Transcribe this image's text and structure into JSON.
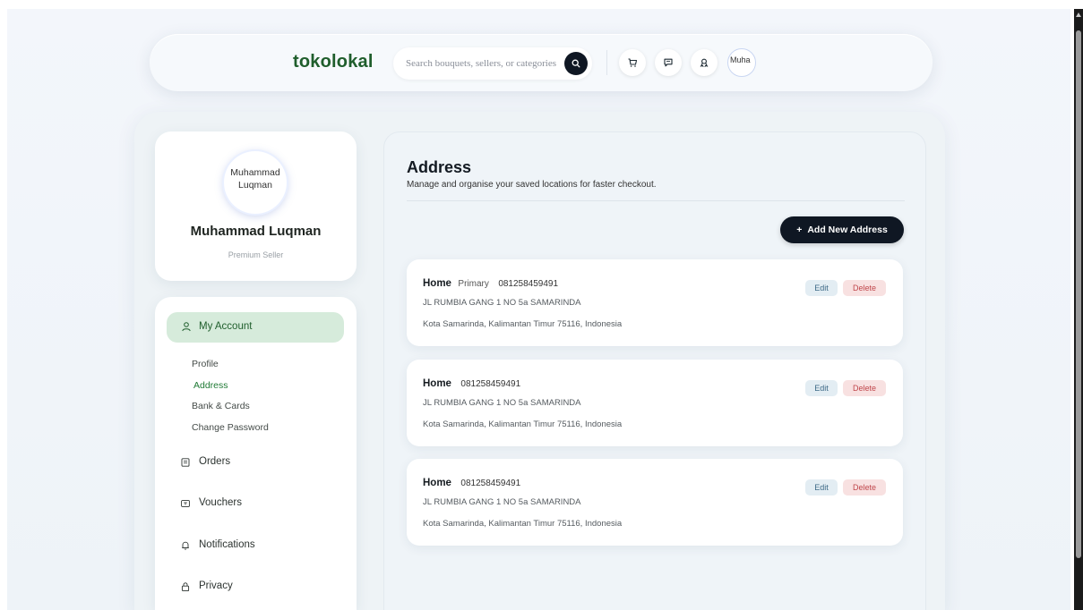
{
  "header": {
    "logo": "tokolokal",
    "search_placeholder": "Search bouquets, sellers, or categories",
    "avatar_alt": "Muha"
  },
  "profile": {
    "avatar_alt_line1": "Muhammad",
    "avatar_alt_line2": "Luqman",
    "name": "Muhammad Luqman",
    "role": "Premium Seller"
  },
  "sidebar": {
    "my_account": "My Account",
    "subitems": [
      "Profile",
      "Address",
      "Bank & Cards",
      "Change Password"
    ],
    "active_subitem": "Address",
    "orders": "Orders",
    "vouchers": "Vouchers",
    "notifications": "Notifications",
    "privacy": "Privacy"
  },
  "content": {
    "title": "Address",
    "subtitle": "Manage and organise your saved locations for faster checkout.",
    "add_button": "Add New Address",
    "add_button_icon": "+",
    "addresses": [
      {
        "label": "Home",
        "primary": "Primary",
        "phone": "081258459491",
        "line1": "JL RUMBIA GANG 1 NO 5a SAMARINDA",
        "line2": "Kota Samarinda, Kalimantan Timur 75116, Indonesia",
        "edit": "Edit",
        "delete": "Delete"
      },
      {
        "label": "Home",
        "primary": "",
        "phone": "081258459491",
        "line1": "JL RUMBIA GANG 1 NO 5a SAMARINDA",
        "line2": "Kota Samarinda, Kalimantan Timur 75116, Indonesia",
        "edit": "Edit",
        "delete": "Delete"
      },
      {
        "label": "Home",
        "primary": "",
        "phone": "081258459491",
        "line1": "JL RUMBIA GANG 1 NO 5a SAMARINDA",
        "line2": "Kota Samarinda, Kalimantan Timur 75116, Indonesia",
        "edit": "Edit",
        "delete": "Delete"
      }
    ]
  },
  "colors": {
    "brand_green": "#1f5e2c",
    "active_nav_bg": "#d6ebdb",
    "dark_button": "#0f1723",
    "edit_bg": "#e3edf3",
    "delete_bg": "#f8e1e1",
    "delete_text": "#c0474c"
  },
  "icons": {
    "search": "search-icon",
    "cart": "cart-icon",
    "chat": "chat-icon",
    "favorite": "ribbon-icon",
    "account": "user-icon",
    "orders": "receipt-icon",
    "vouchers": "ticket-icon",
    "notifications": "bell-icon",
    "privacy": "lock-icon"
  }
}
